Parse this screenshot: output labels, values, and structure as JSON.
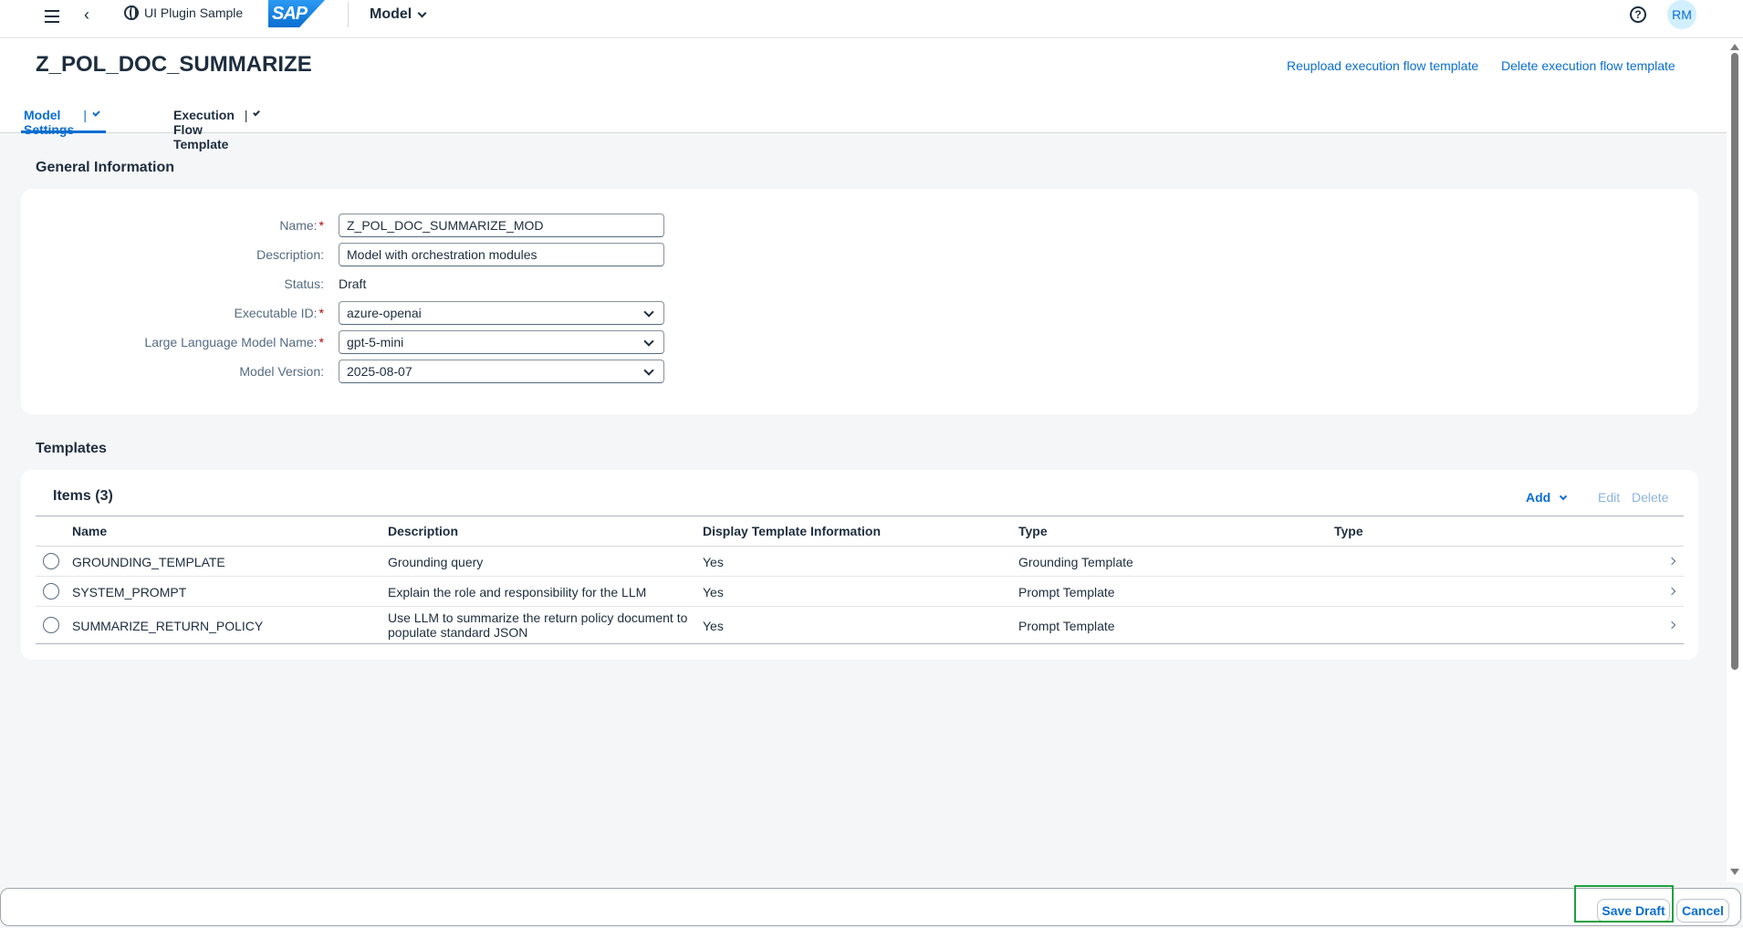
{
  "shell": {
    "plugin_label": "UI Plugin Sample",
    "logo_text": "SAP",
    "model_label": "Model",
    "help_symbol": "?",
    "avatar_initials": "RM"
  },
  "header": {
    "title": "Z_POL_DOC_SUMMARIZE",
    "reupload_link": "Reupload execution flow template",
    "delete_link": "Delete execution flow template"
  },
  "tabs": [
    {
      "label": "Model Settings",
      "active": true
    },
    {
      "label": "Execution Flow Template",
      "active": false
    }
  ],
  "general": {
    "title": "General Information",
    "fields": {
      "name": {
        "label": "Name:",
        "value": "Z_POL_DOC_SUMMARIZE_MOD"
      },
      "description": {
        "label": "Description:",
        "value": "Model with orchestration modules"
      },
      "status": {
        "label": "Status:",
        "value": "Draft"
      },
      "executable": {
        "label": "Executable ID:",
        "value": "azure-openai"
      },
      "llm": {
        "label": "Large Language Model Name:",
        "value": "gpt-5-mini"
      },
      "version": {
        "label": "Model Version:",
        "value": "2025-08-07"
      }
    }
  },
  "templates": {
    "title": "Templates",
    "items_header": "Items (3)",
    "toolbar": {
      "add": "Add",
      "edit": "Edit",
      "delete": "Delete"
    },
    "columns": [
      "Name",
      "Description",
      "Display Template Information",
      "Type",
      "Type"
    ],
    "rows": [
      {
        "name": "GROUNDING_TEMPLATE",
        "description": "Grounding query",
        "display": "Yes",
        "type": "Grounding Template",
        "type2": ""
      },
      {
        "name": "SYSTEM_PROMPT",
        "description": "Explain the role and responsibility for the LLM",
        "display": "Yes",
        "type": "Prompt Template",
        "type2": ""
      },
      {
        "name": "SUMMARIZE_RETURN_POLICY",
        "description": "Use LLM to summarize the return policy document to populate standard JSON",
        "display": "Yes",
        "type": "Prompt Template",
        "type2": ""
      }
    ]
  },
  "footer": {
    "save_draft": "Save Draft",
    "cancel": "Cancel"
  }
}
